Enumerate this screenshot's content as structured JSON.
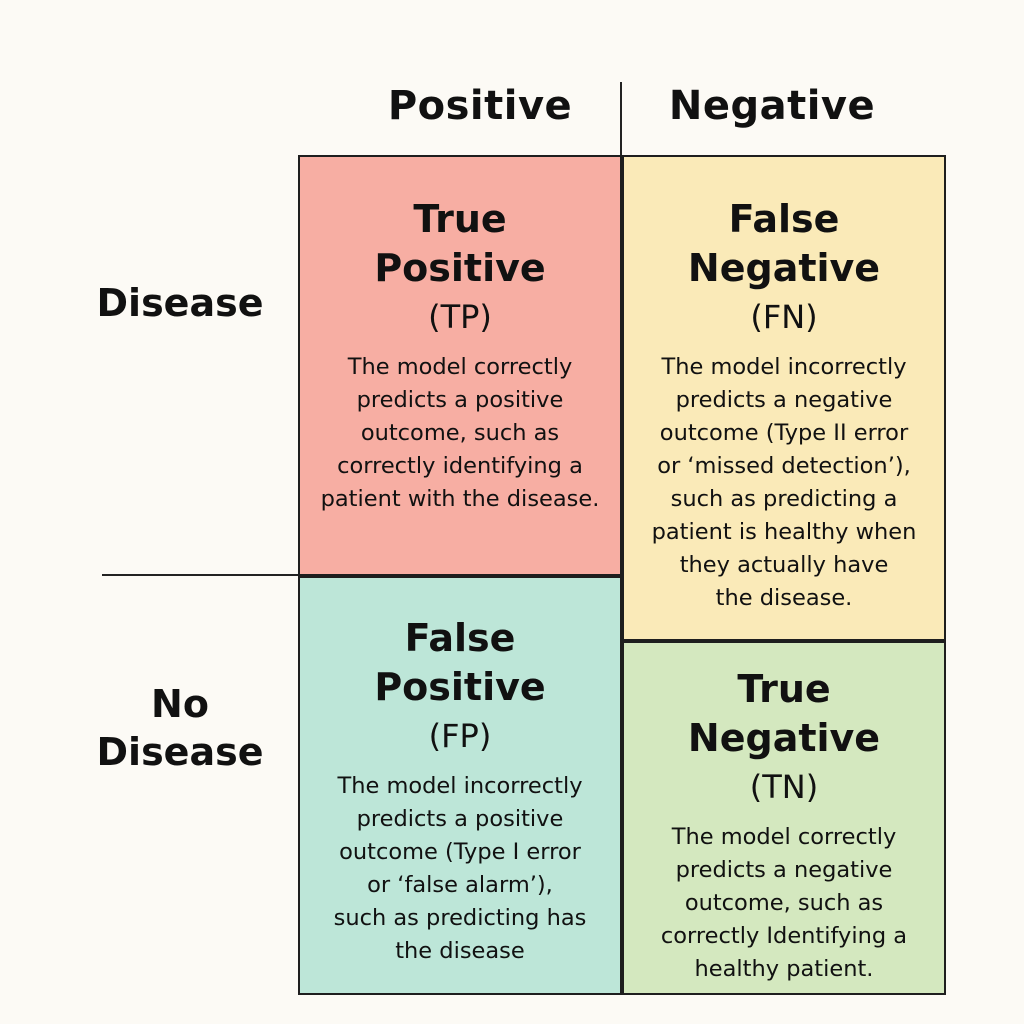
{
  "columns": {
    "positive": "Positive",
    "negative": "Negative"
  },
  "rows": {
    "disease": "Disease",
    "no_disease_line1": "No",
    "no_disease_line2": "Disease"
  },
  "cells": {
    "tp": {
      "title_line1": "True",
      "title_line2": "Positive",
      "abbr": "(TP)",
      "description": "The model correctly\npredicts a positive\noutcome, such as\ncorrectly identifying a\npatient with the disease.",
      "color": "#f7aea3"
    },
    "fn": {
      "title_line1": "False",
      "title_line2": "Negative",
      "abbr": "(FN)",
      "description": "The model incorrectly\npredicts a negative\noutcome (Type II error\nor ‘missed detection’),\nsuch as predicting a\npatient is healthy when\nthey actually have\nthe disease.",
      "color": "#faeab8"
    },
    "fp": {
      "title_line1": "False",
      "title_line2": "Positive",
      "abbr": "(FP)",
      "description": "The model incorrectly\npredicts a positive\noutcome (Type I error\nor ‘false alarm’),\nsuch as predicting has\nthe disease",
      "color": "#bde6d8"
    },
    "tn": {
      "title_line1": "True",
      "title_line2": "Negative",
      "abbr": "(TN)",
      "description": "The model correctly\npredicts a negative\noutcome, such as\ncorrectly Identifying a\nhealthy patient.",
      "color": "#d4e8bf"
    }
  }
}
